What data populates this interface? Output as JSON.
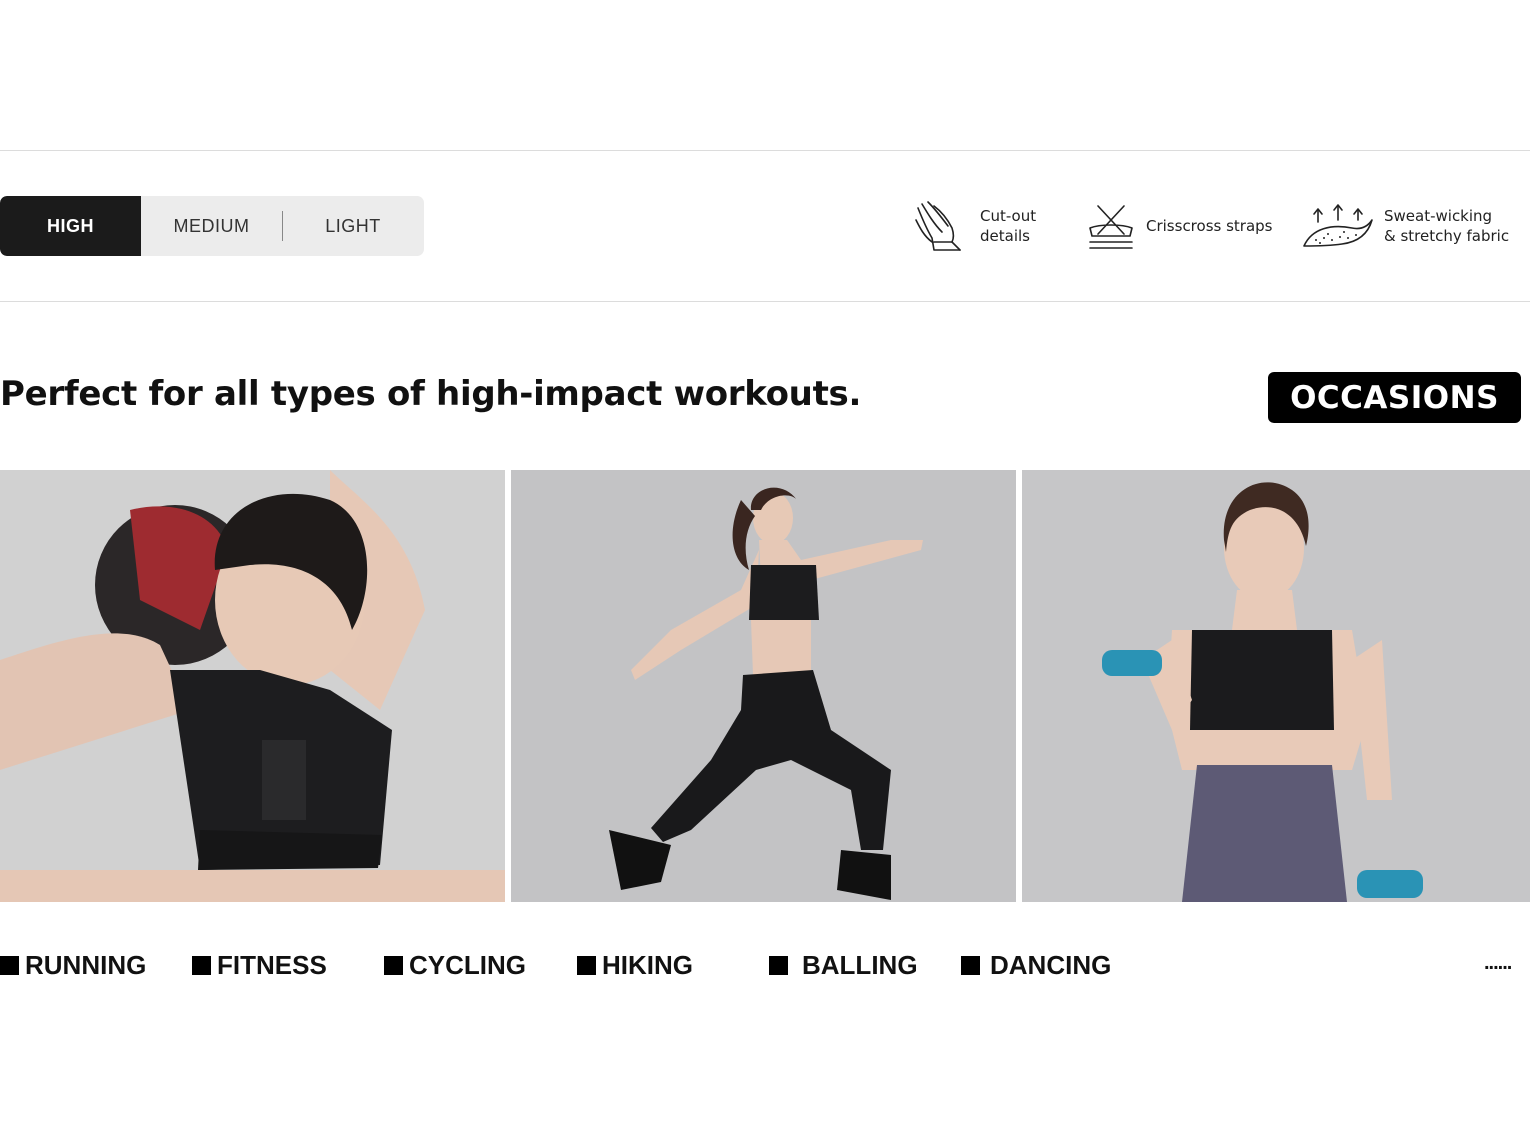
{
  "impact_levels": {
    "selected": "HIGH",
    "tabs": [
      {
        "label": "HIGH"
      },
      {
        "label": "MEDIUM"
      },
      {
        "label": "LIGHT"
      }
    ]
  },
  "features": [
    {
      "icon": "cutout-hand-icon",
      "text": "Cut-out\ndetails"
    },
    {
      "icon": "crisscross-straps-icon",
      "text": "Crisscross straps"
    },
    {
      "icon": "fabric-arrows-icon",
      "text": "Sweat-wicking\n& stretchy fabric"
    }
  ],
  "headline": "Perfect for all types of high-impact workouts.",
  "badge": "OCCASIONS",
  "photos": [
    {
      "name": "photo-ball-pose"
    },
    {
      "name": "photo-running-pose"
    },
    {
      "name": "photo-dumbbell-pose"
    }
  ],
  "activities": [
    {
      "label": "RUNNING"
    },
    {
      "label": "FITNESS"
    },
    {
      "label": "CYCLING"
    },
    {
      "label": "HIKING"
    },
    {
      "label": "BALLING"
    },
    {
      "label": "DANCING"
    }
  ],
  "more": "......",
  "colors": {
    "accent_dark": "#1b1b1b",
    "tab_background": "#ececec",
    "photo_background": "#c4c4c6"
  }
}
